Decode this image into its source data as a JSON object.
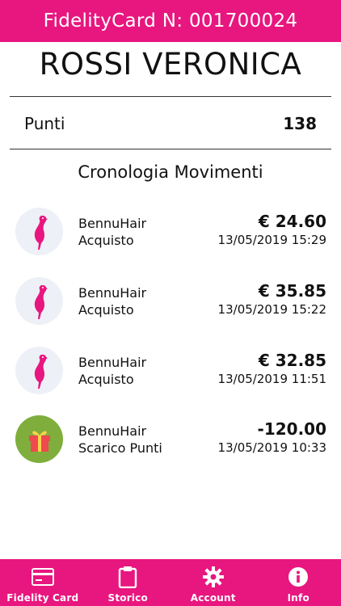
{
  "header": {
    "title": "FidelityCard N: 001700024",
    "background_color": "#e8167f"
  },
  "customer": {
    "name": "ROSSI VERONICA"
  },
  "points": {
    "label": "Punti",
    "value": "138"
  },
  "history": {
    "title": "Cronologia Movimenti",
    "items": [
      {
        "icon": "flamingo-logo-icon",
        "merchant": "BennuHair",
        "type": "Acquisto",
        "amount": "€ 24.60",
        "datetime": "13/05/2019 15:29"
      },
      {
        "icon": "flamingo-logo-icon",
        "merchant": "BennuHair",
        "type": "Acquisto",
        "amount": "€ 35.85",
        "datetime": "13/05/2019 15:22"
      },
      {
        "icon": "flamingo-logo-icon",
        "merchant": "BennuHair",
        "type": "Acquisto",
        "amount": "€ 32.85",
        "datetime": "13/05/2019 11:51"
      },
      {
        "icon": "gift-icon",
        "merchant": "BennuHair",
        "type": "Scarico Punti",
        "amount": "-120.00",
        "datetime": "13/05/2019 10:33"
      }
    ]
  },
  "tabbar": {
    "tabs": [
      {
        "label": "Fidelity Card",
        "icon": "credit-card-icon"
      },
      {
        "label": "Storico",
        "icon": "clipboard-icon"
      },
      {
        "label": "Account",
        "icon": "gear-icon"
      },
      {
        "label": "Info",
        "icon": "info-icon"
      }
    ]
  },
  "colors": {
    "accent": "#e8167f",
    "gift_bg": "#7fae3c",
    "logo_bg": "#eef0f7"
  }
}
